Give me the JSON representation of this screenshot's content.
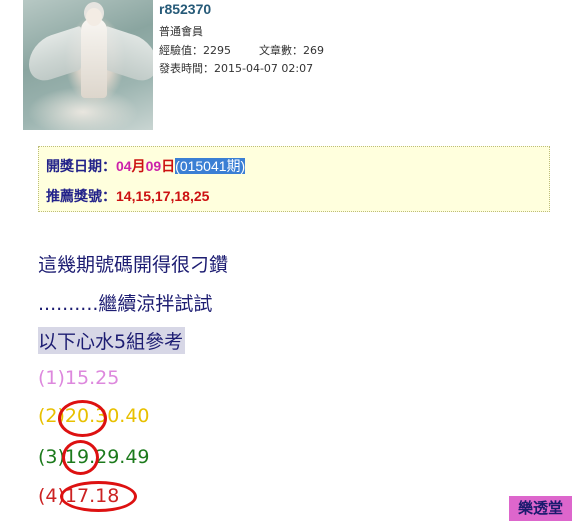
{
  "user": {
    "name": "r852370",
    "group": "普通會員",
    "exp_label": "經驗值：",
    "exp_value": "2295",
    "posts_label": "文章數：",
    "posts_value": "269",
    "post_time_label": "發表時間：",
    "post_time_value": "2015-04-07 02:07"
  },
  "lottery": {
    "date_label": "開獎日期：",
    "month": "04",
    "month_unit": "月",
    "day": "09",
    "day_unit": "日",
    "issue": "(015041期)",
    "recommend_label": "推薦獎號：",
    "recommend_numbers": "14,15,17,18,25"
  },
  "post": {
    "line1": "這幾期號碼開得很刁鑽",
    "line2": "..........繼續涼拌試試",
    "line3": "以下心水5組參考",
    "groups": [
      "(1)15.25",
      "(2)20.30.40",
      "(3)19.29.49",
      "(4)17.18"
    ]
  },
  "stamp": "樂透堂",
  "colors": {
    "username": "#265a78",
    "box_bg": "#ffffdd",
    "label_navy": "#22228a",
    "number_red": "#cc1111",
    "date_magenta": "#cc22aa",
    "selection_blue": "#3b7fd4",
    "text_navy": "#1d1d72",
    "group1": "#dd88dd",
    "group2": "#e8c000",
    "group3": "#1c7a1c",
    "group4": "#cc2222",
    "circle_red": "#dd1111",
    "stamp_bg": "#dd66cc"
  }
}
